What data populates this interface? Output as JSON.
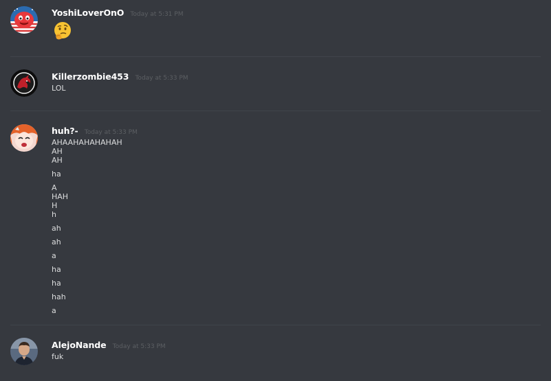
{
  "messages": [
    {
      "username": "YoshiLoverOnO",
      "timestamp": "Today at 5:31 PM",
      "avatar_icon": "red-blob-avatar",
      "emoji_icon": "thinking-face-emoji",
      "lines": []
    },
    {
      "username": "Killerzombie453",
      "timestamp": "Today at 5:33 PM",
      "avatar_icon": "red-dragon-avatar",
      "lines": [
        "LOL"
      ]
    },
    {
      "username": "huh?-",
      "timestamp": "Today at 5:33 PM",
      "avatar_icon": "anime-girl-avatar",
      "lines": [
        "AHAAHAHAHAHAH",
        "AH",
        "AH",
        "ha",
        "A",
        "HAH",
        "H",
        "h",
        "ah",
        "ah",
        "a",
        "ha",
        "ha",
        "hah",
        "a"
      ]
    },
    {
      "username": "AlejoNande",
      "timestamp": "Today at 5:33 PM",
      "avatar_icon": "person-photo-avatar",
      "lines": [
        "fuk"
      ]
    }
  ],
  "colors": {
    "background": "#36393f",
    "username": "#ffffff",
    "timestamp": "#5c5f63",
    "text": "#dcddde",
    "divider": "#40444b"
  }
}
